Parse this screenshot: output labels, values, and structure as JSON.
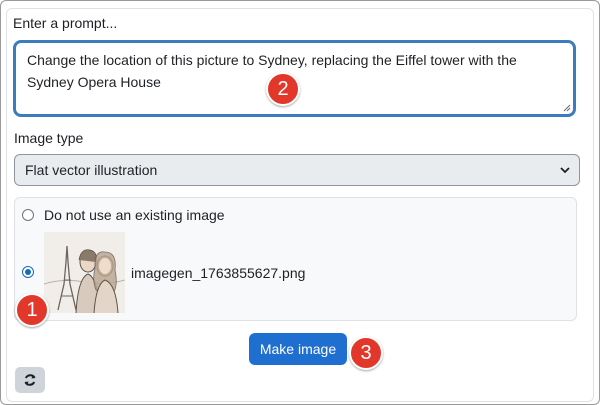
{
  "prompt": {
    "label": "Enter a prompt...",
    "value": "Change the location of this picture to Sydney, replacing the Eiffel tower with the Sydney Opera House"
  },
  "image_type": {
    "label": "Image type",
    "selected": "Flat vector illustration"
  },
  "image_source": {
    "option_none": "Do not use an existing image",
    "option_existing_filename": "imagegen_1763855627.png",
    "selected": "imagegen_1763855627.png"
  },
  "actions": {
    "make_image": "Make image",
    "refresh_icon": "refresh-icon"
  },
  "annotations": [
    "1",
    "2",
    "3"
  ],
  "colors": {
    "accent": "#1f6fd0",
    "badge": "#e2372b",
    "focus_border": "#3d7bbf"
  }
}
